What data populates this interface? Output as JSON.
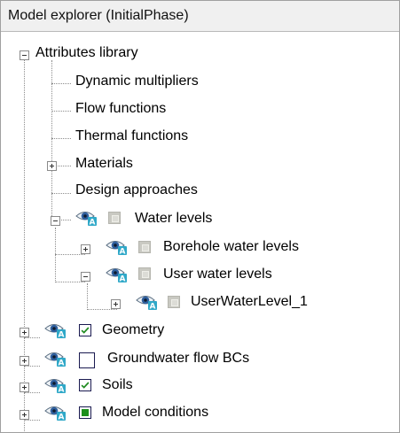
{
  "panel": {
    "title": "Model explorer (InitialPhase)"
  },
  "tree": {
    "attributes_library": "Attributes library",
    "dynamic_multipliers": "Dynamic multipliers",
    "flow_functions": "Flow functions",
    "thermal_functions": "Thermal functions",
    "materials": "Materials",
    "design_approaches": "Design approaches",
    "water_levels": "Water levels",
    "borehole_water_levels": "Borehole water levels",
    "user_water_levels": "User water levels",
    "user_water_level_1": "UserWaterLevel_1",
    "geometry": "Geometry",
    "groundwater_flow_bcs": "Groundwater flow BCs",
    "soils": "Soils",
    "model_conditions": "Model conditions"
  },
  "icons": {
    "expanded": "minus-expander-icon",
    "collapsed": "plus-expander-icon",
    "visibility": "eye-icon",
    "badge": "A"
  },
  "states": {
    "water_levels": "gray",
    "borehole_water_levels": "gray",
    "user_water_levels": "gray",
    "user_water_level_1": "gray",
    "geometry": "checked",
    "groundwater_flow_bcs": "unchecked",
    "soils": "checked",
    "model_conditions": "partial"
  },
  "colors": {
    "check": "#1f8b1f",
    "eye_iris": "#2f5f9e",
    "badge": "#2fa8c8",
    "disabled_box": "#c9c9c2"
  }
}
